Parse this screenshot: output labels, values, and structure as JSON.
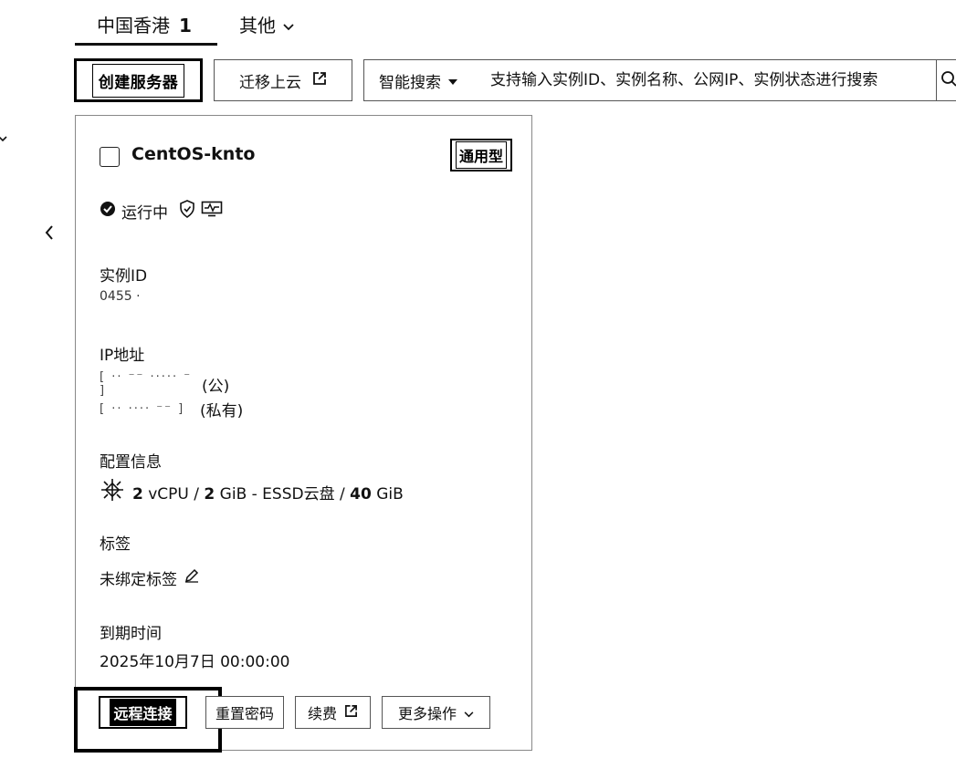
{
  "region_tabs": [
    {
      "label": "中国香港",
      "count": "1",
      "active": true
    },
    {
      "label": "其他",
      "active": false
    }
  ],
  "toolbar": {
    "create_label": "创建服务器",
    "migrate_label": "迁移上云",
    "search_type_label": "智能搜索",
    "search_placeholder": "支持输入实例ID、实例名称、公网IP、实例状态进行搜索"
  },
  "instance": {
    "name": "CentOS-knto",
    "type_badge": "通用型",
    "status": "运行中",
    "id_label": "实例ID",
    "id_value_fragment": "0455 ·",
    "ip_label": "IP地址",
    "public_ip_suffix": "(公)",
    "private_ip_suffix": "(私有)",
    "config_label": "配置信息",
    "config_cpu": "2",
    "config_cpu_unit": " vCPU / ",
    "config_mem": "2",
    "config_mem_unit": " GiB - ESSD云盘 / ",
    "config_disk": "40",
    "config_disk_unit": " GiB",
    "tags_label": "标签",
    "tags_value": "未绑定标签",
    "expire_label": "到期时间",
    "expire_value": "2025年10月7日 00:00:00"
  },
  "actions": {
    "remote_label": "远程连接",
    "reset_label": "重置密码",
    "renew_label": "续费",
    "more_label": "更多操作"
  },
  "icons": {
    "external_link": "external-link-icon",
    "dropdown": "chevron-down-icon",
    "search": "search-icon",
    "running": "check-circle-icon",
    "security": "shield-icon",
    "monitor": "monitor-icon",
    "os": "centos-logo-icon",
    "edit": "edit-pencil-icon"
  }
}
